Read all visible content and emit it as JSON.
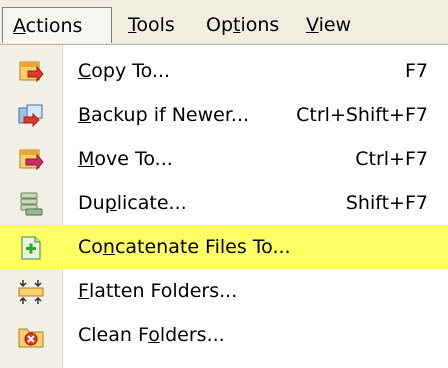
{
  "menubar": {
    "items": [
      {
        "label_a": "A",
        "label_b": "ctions"
      },
      {
        "label_a": "T",
        "label_b": "ools"
      },
      {
        "label_a": "Op",
        "label_u": "t",
        "label_b": "ions"
      },
      {
        "label_a": "V",
        "label_b": "iew"
      }
    ]
  },
  "menu": {
    "items": [
      {
        "pre": "",
        "u": "C",
        "post": "opy To...",
        "shortcut": "F7",
        "icon": "copy-to-icon"
      },
      {
        "pre": "",
        "u": "B",
        "post": "ackup if Newer...",
        "shortcut": "Ctrl+Shift+F7",
        "icon": "backup-icon"
      },
      {
        "pre": "",
        "u": "M",
        "post": "ove To...",
        "shortcut": "Ctrl+F7",
        "icon": "move-to-icon"
      },
      {
        "pre": "Du",
        "u": "p",
        "post": "licate...",
        "shortcut": "Shift+F7",
        "icon": "duplicate-icon"
      },
      {
        "pre": "Co",
        "u": "n",
        "post": "catenate Files To...",
        "shortcut": "",
        "icon": "concatenate-icon"
      },
      {
        "pre": "",
        "u": "F",
        "post": "latten Folders...",
        "shortcut": "",
        "icon": "flatten-icon"
      },
      {
        "pre": "Clean F",
        "u": "o",
        "post": "lders...",
        "shortcut": "",
        "icon": "clean-folders-icon"
      }
    ]
  },
  "colors": {
    "highlight": "#ffff66",
    "menubar": "#f0ede1",
    "gutter": "#f1efe6"
  }
}
